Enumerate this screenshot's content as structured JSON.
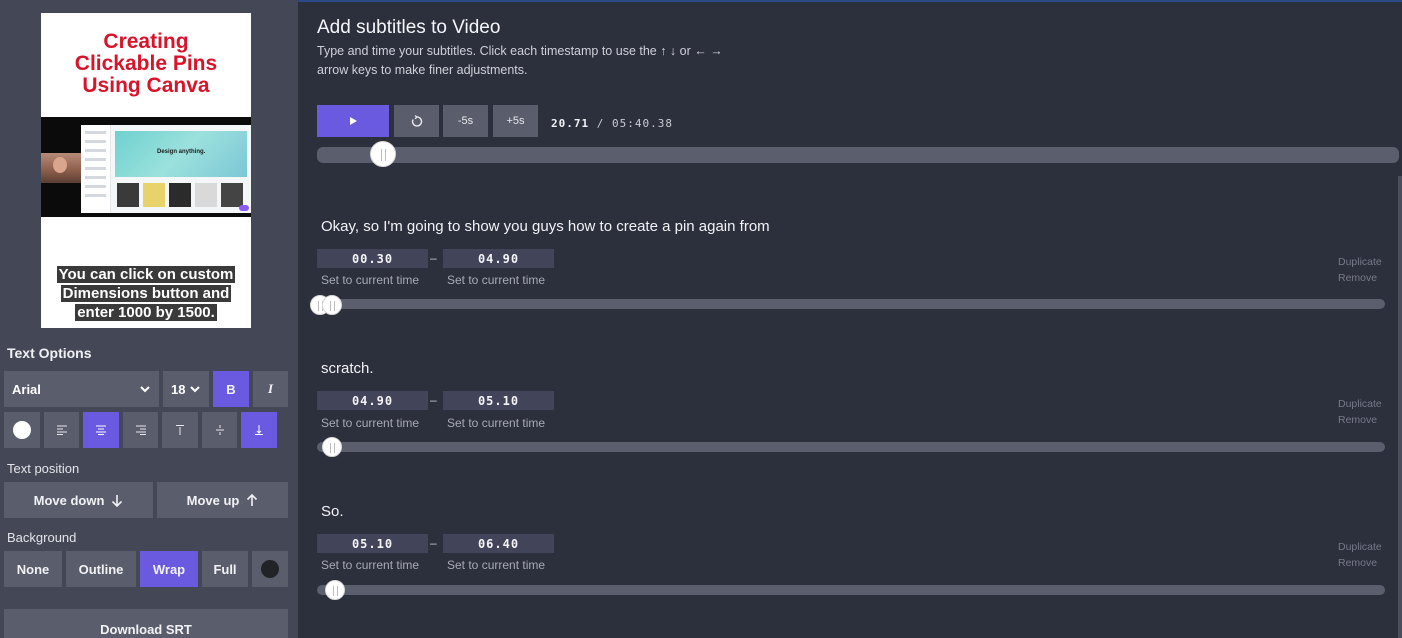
{
  "preview": {
    "pin_title_lines": [
      "Creating",
      "Clickable Pins",
      "Using Canva"
    ],
    "screen_banner_text": "Design anything.",
    "caption_lines": [
      "You can click on custom",
      "Dimensions button and",
      "enter 1000 by 1500."
    ]
  },
  "text_options": {
    "heading": "Text Options",
    "font": "Arial",
    "size": "18",
    "bold_label": "B",
    "italic_label": "I"
  },
  "text_position": {
    "heading": "Text position",
    "move_down": "Move down",
    "move_up": "Move up"
  },
  "background": {
    "heading": "Background",
    "options": [
      "None",
      "Outline",
      "Wrap",
      "Full"
    ],
    "selected": "Wrap"
  },
  "download_label": "Download SRT",
  "main": {
    "title": "Add subtitles to Video",
    "subtitle_line1": "Type and time your subtitles. Click each timestamp to use the ↑ ↓ or ← →",
    "subtitle_line2": "arrow keys to make finer adjustments."
  },
  "player": {
    "minus_label": "-5s",
    "plus_label": "+5s",
    "current_time": "20.71",
    "separator": "/",
    "total_time": "05:40.38",
    "progress_fraction": 0.0609
  },
  "subtitles": [
    {
      "text": "Okay, so I'm going to show you guys how to create a pin again from",
      "start": "00.30",
      "end": "04.90"
    },
    {
      "text": "scratch.",
      "start": "04.90",
      "end": "05.10"
    },
    {
      "text": "So.",
      "start": "05.10",
      "end": "06.40"
    }
  ],
  "labels": {
    "set_current": "Set to current time",
    "dash": "–",
    "duplicate": "Duplicate",
    "remove": "Remove"
  },
  "colors": {
    "accent": "#6a5ae0",
    "panel": "#444756",
    "main_bg": "#2c2f3c",
    "pin_title": "#d9132a"
  }
}
